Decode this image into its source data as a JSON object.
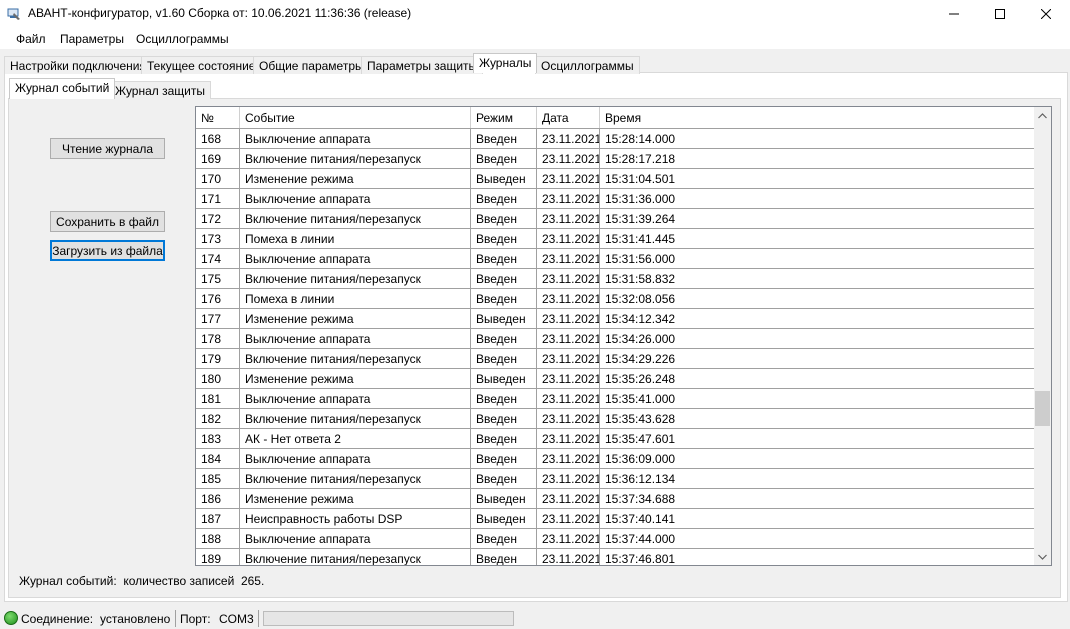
{
  "window": {
    "title": "АВАНТ-конфигуратор, v1.60 Сборка от: 10.06.2021 11:36:36  (release)"
  },
  "menu": [
    "Файл",
    "Параметры",
    "Осциллограммы"
  ],
  "main_tabs": [
    "Настройки подключения",
    "Текущее состояние",
    "Общие параметры",
    "Параметры защиты",
    "Журналы",
    "Осциллограммы"
  ],
  "main_tabs_active": "Журналы",
  "sub_tabs": [
    "Журнал событий",
    "Журнал защиты"
  ],
  "sub_tabs_active": "Журнал событий",
  "buttons": {
    "read": "Чтение журнала",
    "save": "Сохранить в файл",
    "load": "Загрузить из файла"
  },
  "table": {
    "columns": [
      "№",
      "Событие",
      "Режим",
      "Дата",
      "Время"
    ],
    "rows": [
      [
        "168",
        "Выключение аппарата",
        "Введен",
        "23.11.2021",
        "15:28:14.000"
      ],
      [
        "169",
        "Включение питания/перезапуск",
        "Введен",
        "23.11.2021",
        "15:28:17.218"
      ],
      [
        "170",
        "Изменение режима",
        "Выведен",
        "23.11.2021",
        "15:31:04.501"
      ],
      [
        "171",
        "Выключение аппарата",
        "Введен",
        "23.11.2021",
        "15:31:36.000"
      ],
      [
        "172",
        "Включение питания/перезапуск",
        "Введен",
        "23.11.2021",
        "15:31:39.264"
      ],
      [
        "173",
        "Помеха в линии",
        "Введен",
        "23.11.2021",
        "15:31:41.445"
      ],
      [
        "174",
        "Выключение аппарата",
        "Введен",
        "23.11.2021",
        "15:31:56.000"
      ],
      [
        "175",
        "Включение питания/перезапуск",
        "Введен",
        "23.11.2021",
        "15:31:58.832"
      ],
      [
        "176",
        "Помеха в линии",
        "Введен",
        "23.11.2021",
        "15:32:08.056"
      ],
      [
        "177",
        "Изменение режима",
        "Выведен",
        "23.11.2021",
        "15:34:12.342"
      ],
      [
        "178",
        "Выключение аппарата",
        "Введен",
        "23.11.2021",
        "15:34:26.000"
      ],
      [
        "179",
        "Включение питания/перезапуск",
        "Введен",
        "23.11.2021",
        "15:34:29.226"
      ],
      [
        "180",
        "Изменение режима",
        "Выведен",
        "23.11.2021",
        "15:35:26.248"
      ],
      [
        "181",
        "Выключение аппарата",
        "Введен",
        "23.11.2021",
        "15:35:41.000"
      ],
      [
        "182",
        "Включение питания/перезапуск",
        "Введен",
        "23.11.2021",
        "15:35:43.628"
      ],
      [
        "183",
        "АК - Нет ответа 2",
        "Введен",
        "23.11.2021",
        "15:35:47.601"
      ],
      [
        "184",
        "Выключение аппарата",
        "Введен",
        "23.11.2021",
        "15:36:09.000"
      ],
      [
        "185",
        "Включение питания/перезапуск",
        "Введен",
        "23.11.2021",
        "15:36:12.134"
      ],
      [
        "186",
        "Изменение режима",
        "Выведен",
        "23.11.2021",
        "15:37:34.688"
      ],
      [
        "187",
        "Неисправность работы DSP",
        "Выведен",
        "23.11.2021",
        "15:37:40.141"
      ],
      [
        "188",
        "Выключение аппарата",
        "Введен",
        "23.11.2021",
        "15:37:44.000"
      ],
      [
        "189",
        "Включение питания/перезапуск",
        "Введен",
        "23.11.2021",
        "15:37:46.801"
      ]
    ]
  },
  "summary": {
    "label": "Журнал событий:",
    "text": "количество записей",
    "count": "265."
  },
  "status": {
    "connection_label": "Соединение:",
    "connection_value": "установлено",
    "port_label": "Порт:",
    "port_value": "COM3"
  },
  "colors": {
    "accent": "#0078d7",
    "status_ok": "#2ea82a"
  },
  "icons": [
    "app-icon",
    "minimize-icon",
    "maximize-icon",
    "close-icon",
    "scroll-up-icon",
    "scroll-down-icon",
    "connection-status-icon"
  ]
}
